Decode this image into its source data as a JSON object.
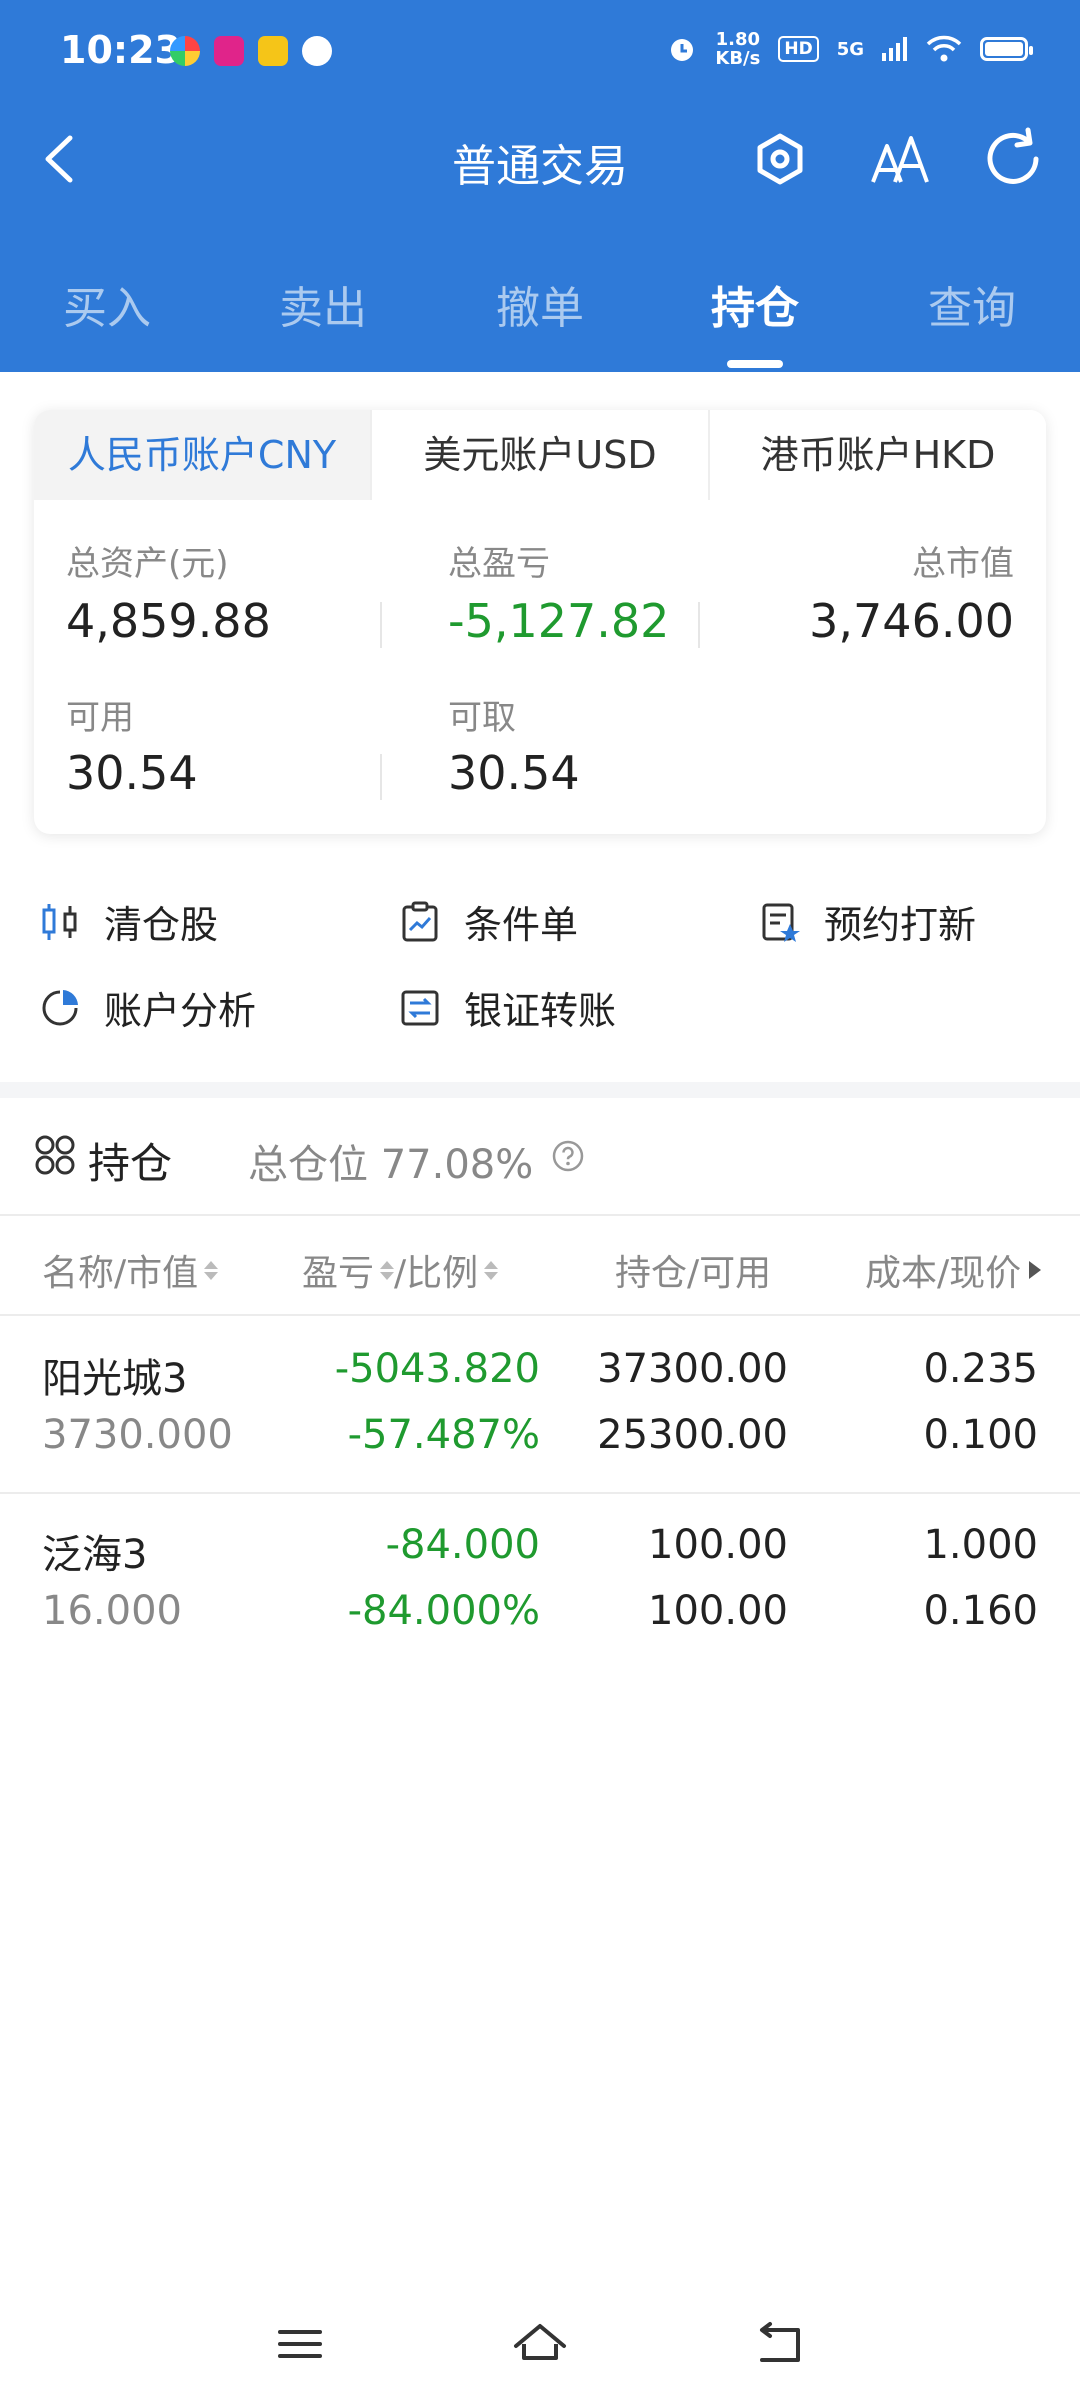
{
  "status": {
    "time": "10:23",
    "speed_top": "1.80",
    "speed_bottom": "KB/s",
    "hd": "HD",
    "net": "5G"
  },
  "nav": {
    "title": "普通交易"
  },
  "tabs": [
    "买入",
    "卖出",
    "撤单",
    "持仓",
    "查询"
  ],
  "active_tab": "持仓",
  "accounts": [
    "人民币账户CNY",
    "美元账户USD",
    "港币账户HKD"
  ],
  "summary": {
    "total_assets_label": "总资产(元)",
    "total_assets": "4,859.88",
    "total_pl_label": "总盈亏",
    "total_pl": "-5,127.82",
    "market_value_label": "总市值",
    "market_value": "3,746.00",
    "available_label": "可用",
    "available": "30.54",
    "withdrawable_label": "可取",
    "withdrawable": "30.54"
  },
  "actions": [
    "清仓股",
    "条件单",
    "预约打新",
    "账户分析",
    "银证转账"
  ],
  "positions_header": {
    "title": "持仓",
    "ratio_label": "总仓位",
    "ratio": "77.08%"
  },
  "columns": {
    "name": "名称/市值",
    "pl": "盈亏",
    "ratio": "/比例",
    "hold": "持仓/可用",
    "cost": "成本/现价"
  },
  "rows": [
    {
      "name": "阳光城3",
      "market_value": "3730.000",
      "pl": "-5043.820",
      "pl_ratio": "-57.487%",
      "hold": "37300.00",
      "avail": "25300.00",
      "cost": "0.235",
      "price": "0.100"
    },
    {
      "name": "泛海3",
      "market_value": "16.000",
      "pl": "-84.000",
      "pl_ratio": "-84.000%",
      "hold": "100.00",
      "avail": "100.00",
      "cost": "1.000",
      "price": "0.160"
    }
  ],
  "colors": {
    "brand": "#2f7ad8",
    "loss": "#1f9a2f"
  }
}
